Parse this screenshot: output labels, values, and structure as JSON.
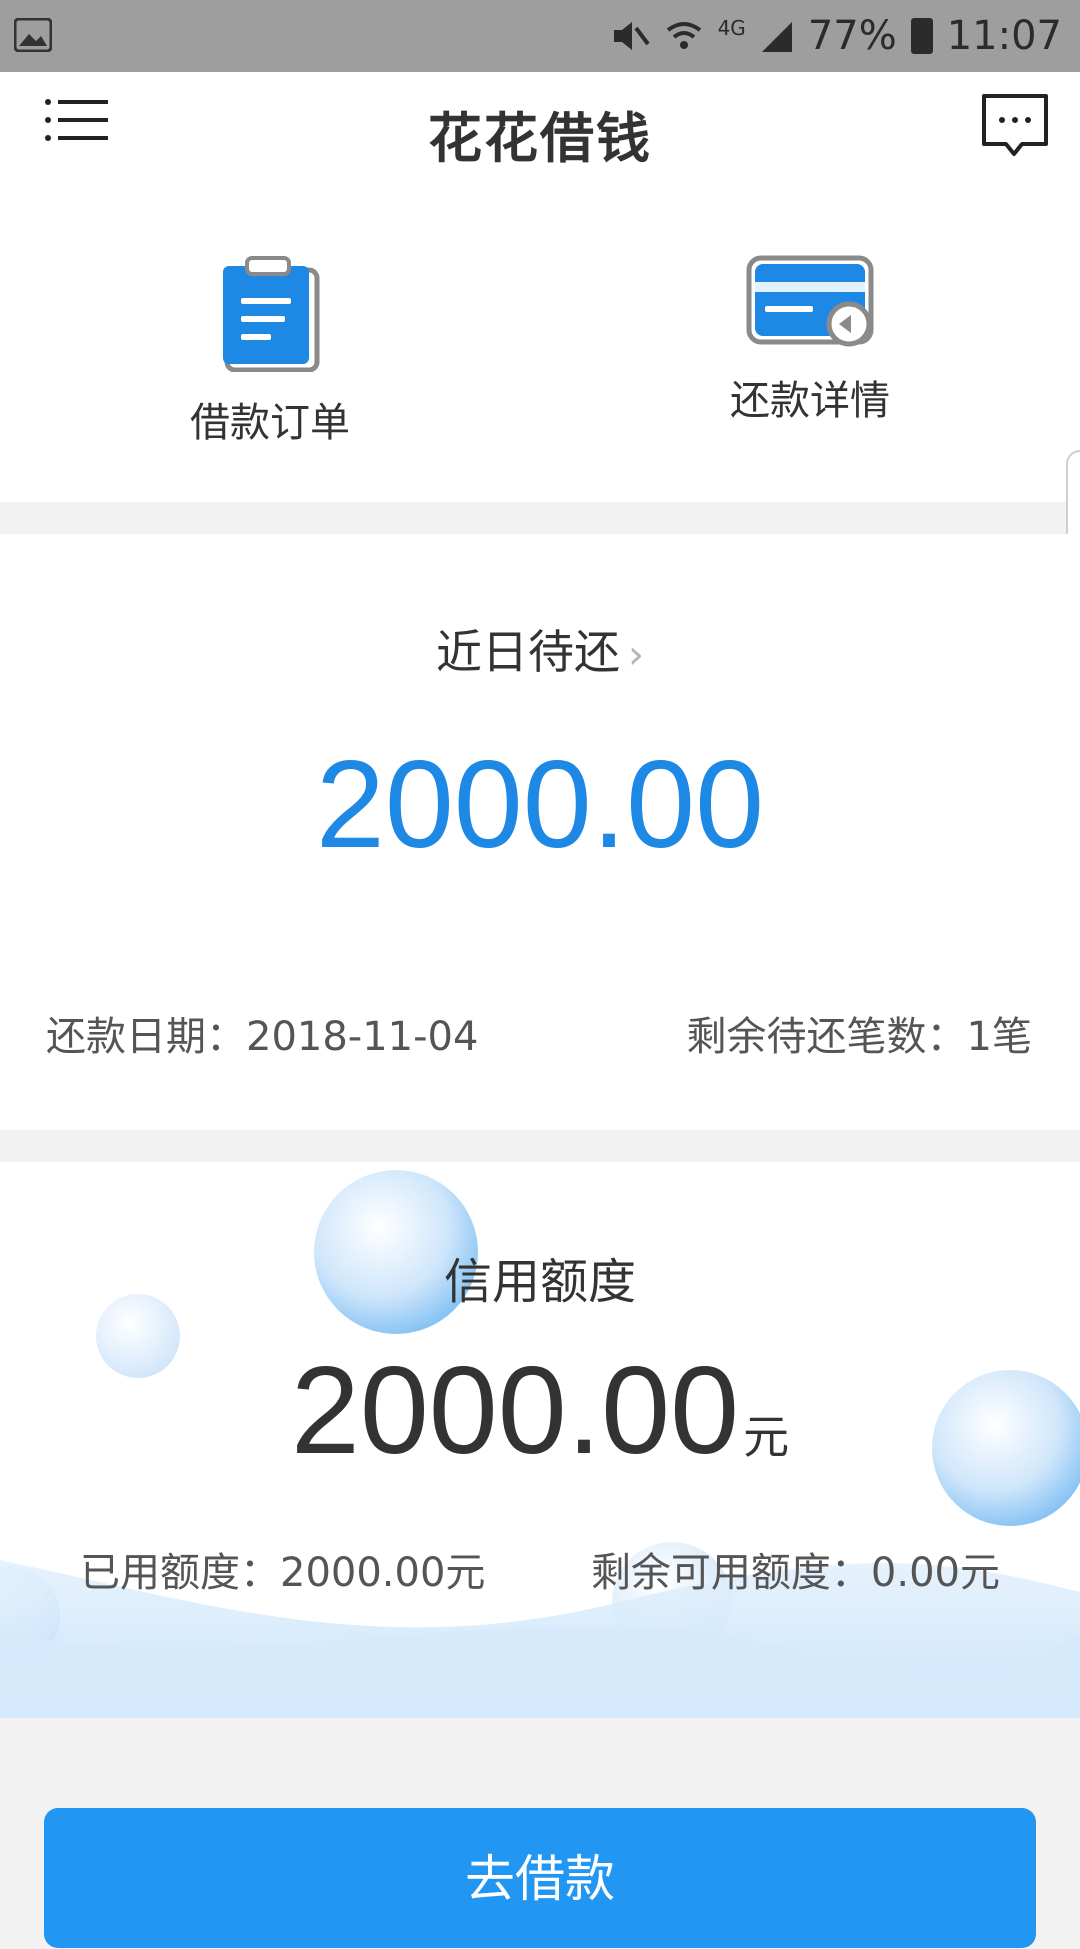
{
  "status_bar": {
    "battery": "77%",
    "time": "11:07",
    "network": "4G"
  },
  "header": {
    "title": "花花借钱"
  },
  "shortcuts": [
    {
      "label": "借款订单",
      "icon": "clipboard-icon"
    },
    {
      "label": "还款详情",
      "icon": "card-return-icon"
    }
  ],
  "repayment": {
    "title": "近日待还",
    "amount": "2000.00",
    "date_label": "还款日期：2018-11-04",
    "count_label": "剩余待还笔数：1笔"
  },
  "credit": {
    "title": "信用额度",
    "amount": "2000.00",
    "unit": "元",
    "used_label": "已用额度：2000.00元",
    "remaining_label": "剩余可用额度：0.00元"
  },
  "actions": {
    "borrow_label": "去借款"
  },
  "colors": {
    "accent": "#2196f3",
    "amount_blue": "#1e88e5"
  }
}
